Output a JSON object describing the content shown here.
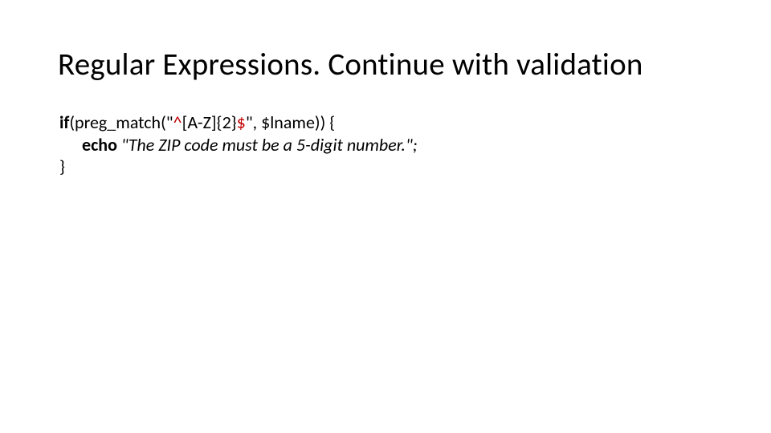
{
  "slide": {
    "title": "Regular Expressions. Continue with validation",
    "code": {
      "line1": {
        "if_kw": "if",
        "preg_open": "(preg_match(\"",
        "regex_caret": "^",
        "regex_class": "[A-Z]{2}",
        "regex_dollar": "$",
        "preg_close": "\", $lname)) {"
      },
      "line2": {
        "echo_kw": "echo",
        "echo_rest": " \"The ZIP code must be a 5-digit number.\";"
      },
      "line3": "}"
    }
  }
}
